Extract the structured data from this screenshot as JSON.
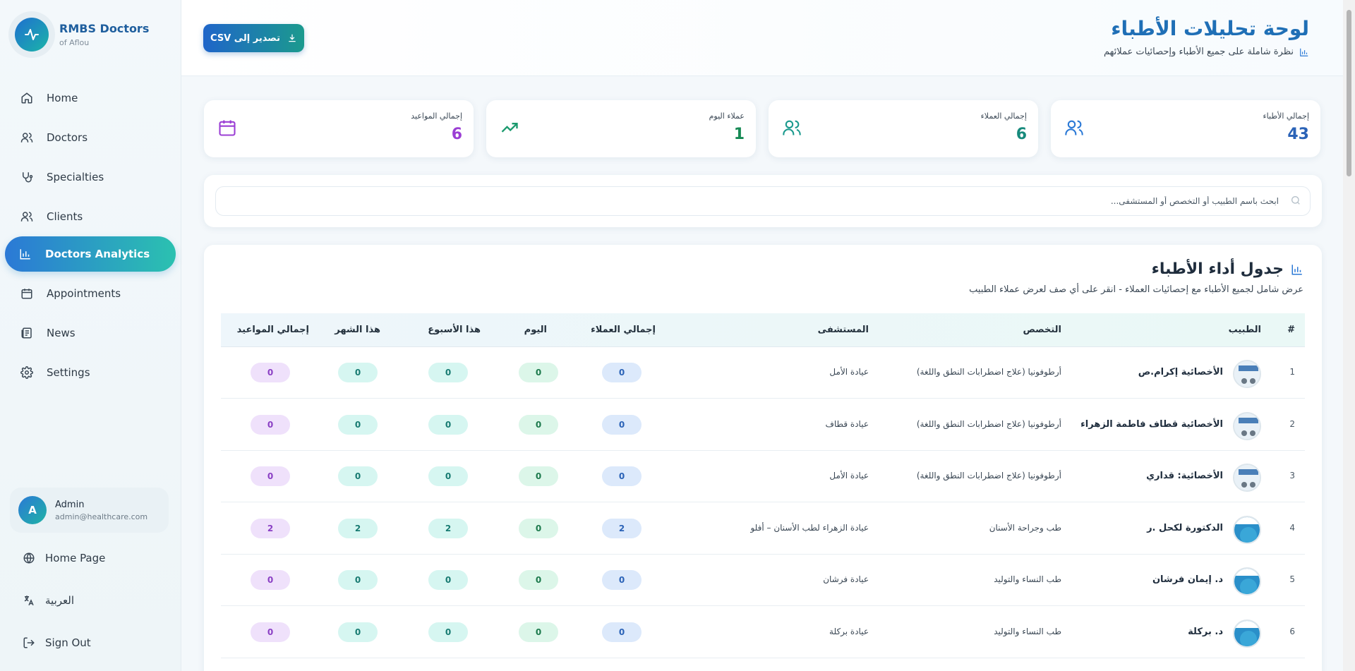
{
  "sidebar": {
    "brand_title": "RMBS Doctors",
    "brand_sub": "of Aflou",
    "items": [
      {
        "label": "Home",
        "icon": "home-icon"
      },
      {
        "label": "Doctors",
        "icon": "users-icon"
      },
      {
        "label": "Specialties",
        "icon": "stethoscope-icon"
      },
      {
        "label": "Clients",
        "icon": "users-icon"
      },
      {
        "label": "Doctors Analytics",
        "icon": "bar-chart-icon",
        "active": true
      },
      {
        "label": "Appointments",
        "icon": "calendar-icon"
      },
      {
        "label": "News",
        "icon": "newspaper-icon"
      },
      {
        "label": "Settings",
        "icon": "gear-icon"
      }
    ],
    "user": {
      "initial": "A",
      "name": "Admin",
      "email": "admin@healthcare.com"
    },
    "bottom": [
      {
        "label": "Home Page",
        "icon": "globe-icon"
      },
      {
        "label": "العربية",
        "icon": "translate-icon"
      },
      {
        "label": "Sign Out",
        "icon": "sign-out-icon"
      }
    ]
  },
  "header": {
    "title": "لوحة تحليلات الأطباء",
    "subtitle": "نظرة شاملة على جميع الأطباء وإحصائيات عملائهم",
    "export_label": "تصدير إلى CSV"
  },
  "stats": [
    {
      "label": "إجمالي الأطباء",
      "value": "43",
      "color": "#2b63b7",
      "icon": "users-icon"
    },
    {
      "label": "إجمالي العملاء",
      "value": "6",
      "color": "#178a7c",
      "icon": "users-icon"
    },
    {
      "label": "عملاء اليوم",
      "value": "1",
      "color": "#178a55",
      "icon": "trending-up-icon"
    },
    {
      "label": "إجمالي المواعيد",
      "value": "6",
      "color": "#9b3fd4",
      "icon": "calendar-icon"
    }
  ],
  "search": {
    "placeholder": "ابحث باسم الطبيب أو التخصص أو المستشفى..."
  },
  "table": {
    "title": "جدول أداء الأطباء",
    "description": "عرض شامل لجميع الأطباء مع إحصائيات العملاء - انقر على أي صف لعرض عملاء الطبيب",
    "columns": {
      "index": "#",
      "doctor": "الطبيب",
      "specialty": "التخصص",
      "hospital": "المستشفى",
      "total_clients": "إجمالي العملاء",
      "today": "اليوم",
      "this_week": "هذا الأسبوع",
      "this_month": "هذا الشهر",
      "total_appointments": "إجمالي المواعيد"
    },
    "rows": [
      {
        "index": "1",
        "doctor": "الأخصائية إكرام.ص",
        "specialty": "أرطوفونيا (علاج اضطرابات النطق واللغة)",
        "hospital": "عيادة الأمل",
        "total_clients": "0",
        "today": "0",
        "this_week": "0",
        "this_month": "0",
        "total_appointments": "0"
      },
      {
        "index": "2",
        "doctor": "الأخصائية قطاف فاطمة الزهراء",
        "specialty": "أرطوفونيا (علاج اضطرابات النطق واللغة)",
        "hospital": "عيادة قطاف",
        "total_clients": "0",
        "today": "0",
        "this_week": "0",
        "this_month": "0",
        "total_appointments": "0"
      },
      {
        "index": "3",
        "doctor": "الأخصائية: قداري",
        "specialty": "أرطوفونيا (علاج اضطرابات النطق واللغة)",
        "hospital": "عيادة الأمل",
        "total_clients": "0",
        "today": "0",
        "this_week": "0",
        "this_month": "0",
        "total_appointments": "0"
      },
      {
        "index": "4",
        "doctor": "الدكتورة لكحل .ر",
        "specialty": "طب وجراحة الأسنان",
        "hospital": "عيادة الزهراء لطب الأسنان – أفلو",
        "total_clients": "2",
        "today": "0",
        "this_week": "2",
        "this_month": "2",
        "total_appointments": "2"
      },
      {
        "index": "5",
        "doctor": "د. إيمان فرشان",
        "specialty": "طب النساء والتوليد",
        "hospital": "عيادة فرشان",
        "total_clients": "0",
        "today": "0",
        "this_week": "0",
        "this_month": "0",
        "total_appointments": "0"
      },
      {
        "index": "6",
        "doctor": "د. بركلة",
        "specialty": "طب النساء والتوليد",
        "hospital": "عيادة بركلة",
        "total_clients": "0",
        "today": "0",
        "this_week": "0",
        "this_month": "0",
        "total_appointments": "0"
      }
    ]
  }
}
